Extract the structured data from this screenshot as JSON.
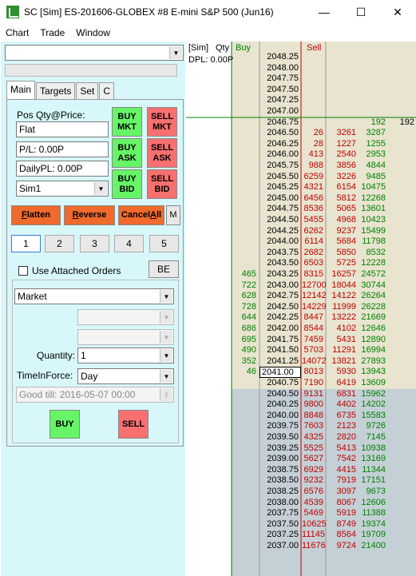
{
  "window": {
    "title": "SC [Sim] ES-201606-GLOBEX  #8  E-mini S&P 500 (Jun16)",
    "minimize": "—",
    "maximize": "☐",
    "close": "✕"
  },
  "menu": [
    "Chart",
    "Trade",
    "Window"
  ],
  "left": {
    "account_combo": "",
    "tabs": [
      "Main",
      "Targets",
      "Set",
      "C"
    ],
    "pos_label": "Pos Qty@Price:",
    "pos_value": "Flat",
    "pl_value": "P/L: 0.00P",
    "daily_pl_value": "DailyPL: 0.00P",
    "account": "Sim1",
    "buy_mkt": [
      "BUY",
      "MKT"
    ],
    "sell_mkt": [
      "SELL",
      "MKT"
    ],
    "buy_ask": [
      "BUY",
      "ASK"
    ],
    "sell_ask": [
      "SELL",
      "ASK"
    ],
    "buy_bid": [
      "BUY",
      "BID"
    ],
    "sell_bid": [
      "SELL",
      "BID"
    ],
    "flatten": "Flatten",
    "reverse": "Reverse",
    "cancel_all": "CancelAll",
    "m": "M",
    "qty_buttons": [
      "1",
      "2",
      "3",
      "4",
      "5"
    ],
    "use_attached": "Use Attached Orders",
    "be": "BE",
    "order_type": "Market",
    "quantity_label": "Quantity:",
    "quantity": "1",
    "tif_label": "TimeInForce:",
    "tif": "Day",
    "good_till": "Good till: 2016-05-07 00:00",
    "buy": "BUY",
    "sell": "SELL"
  },
  "ladder": {
    "header_sim": "[Sim]",
    "header_qty": "Qty",
    "header_buy": "Buy",
    "header_sell": "Sell",
    "dpl": "DPL: 0.00P",
    "colors": {
      "ask_bg": "#e8e4cf",
      "bid_bg": "#c4d0d6",
      "buy": "#008000",
      "sell": "#c00000"
    },
    "rows": [
      {
        "p": "2048.25",
        "b": "",
        "s": "",
        "v1": "",
        "v2": "",
        "v3": "",
        "z": "a"
      },
      {
        "p": "2048.00",
        "b": "",
        "s": "",
        "v1": "",
        "v2": "",
        "v3": "",
        "z": "a"
      },
      {
        "p": "2047.75",
        "b": "",
        "s": "",
        "v1": "",
        "v2": "",
        "v3": "",
        "z": "a"
      },
      {
        "p": "2047.50",
        "b": "",
        "s": "",
        "v1": "",
        "v2": "",
        "v3": "",
        "z": "a"
      },
      {
        "p": "2047.25",
        "b": "",
        "s": "",
        "v1": "",
        "v2": "",
        "v3": "",
        "z": "a"
      },
      {
        "p": "2047.00",
        "b": "",
        "s": "",
        "v1": "",
        "v2": "",
        "v3": "",
        "z": "a"
      },
      {
        "p": "2046.75",
        "b": "",
        "s": "",
        "v1": "",
        "v2": "192",
        "v3": "192",
        "z": "a"
      },
      {
        "p": "2046.50",
        "b": "",
        "s": "26",
        "v1": "3261",
        "v2": "3287",
        "v3": "",
        "z": "a"
      },
      {
        "p": "2046.25",
        "b": "",
        "s": "28",
        "v1": "1227",
        "v2": "1255",
        "v3": "",
        "z": "a"
      },
      {
        "p": "2046.00",
        "b": "",
        "s": "413",
        "v1": "2540",
        "v2": "2953",
        "v3": "",
        "z": "a"
      },
      {
        "p": "2045.75",
        "b": "",
        "s": "988",
        "v1": "3856",
        "v2": "4844",
        "v3": "",
        "z": "a"
      },
      {
        "p": "2045.50",
        "b": "",
        "s": "6259",
        "v1": "3226",
        "v2": "9485",
        "v3": "",
        "z": "a"
      },
      {
        "p": "2045.25",
        "b": "",
        "s": "4321",
        "v1": "6154",
        "v2": "10475",
        "v3": "",
        "z": "a"
      },
      {
        "p": "2045.00",
        "b": "",
        "s": "6456",
        "v1": "5812",
        "v2": "12268",
        "v3": "",
        "z": "a"
      },
      {
        "p": "2044.75",
        "b": "",
        "s": "8536",
        "v1": "5065",
        "v2": "13601",
        "v3": "",
        "z": "a"
      },
      {
        "p": "2044.50",
        "b": "",
        "s": "5455",
        "v1": "4968",
        "v2": "10423",
        "v3": "",
        "z": "a"
      },
      {
        "p": "2044.25",
        "b": "",
        "s": "6262",
        "v1": "9237",
        "v2": "15499",
        "v3": "",
        "z": "a"
      },
      {
        "p": "2044.00",
        "b": "",
        "s": "6114",
        "v1": "5684",
        "v2": "11798",
        "v3": "",
        "z": "a"
      },
      {
        "p": "2043.75",
        "b": "",
        "s": "2682",
        "v1": "5850",
        "v2": "8532",
        "v3": "",
        "z": "a"
      },
      {
        "p": "2043.50",
        "b": "",
        "s": "6503",
        "v1": "5725",
        "v2": "12228",
        "v3": "",
        "z": "a"
      },
      {
        "p": "2043.25",
        "b": "465",
        "s": "8315",
        "v1": "16257",
        "v2": "24572",
        "v3": "",
        "z": "a"
      },
      {
        "p": "2043.00",
        "b": "722",
        "s": "12700",
        "v1": "18044",
        "v2": "30744",
        "v3": "",
        "z": "a"
      },
      {
        "p": "2042.75",
        "b": "628",
        "s": "12142",
        "v1": "14122",
        "v2": "26264",
        "v3": "",
        "z": "a"
      },
      {
        "p": "2042.50",
        "b": "728",
        "s": "14229",
        "v1": "11999",
        "v2": "26228",
        "v3": "",
        "z": "a"
      },
      {
        "p": "2042.25",
        "b": "644",
        "s": "8447",
        "v1": "13222",
        "v2": "21669",
        "v3": "",
        "z": "a"
      },
      {
        "p": "2042.00",
        "b": "686",
        "s": "8544",
        "v1": "4102",
        "v2": "12646",
        "v3": "",
        "z": "a"
      },
      {
        "p": "2041.75",
        "b": "695",
        "s": "7459",
        "v1": "5431",
        "v2": "12890",
        "v3": "",
        "z": "a"
      },
      {
        "p": "2041.50",
        "b": "490",
        "s": "5703",
        "v1": "11291",
        "v2": "16994",
        "v3": "",
        "z": "a"
      },
      {
        "p": "2041.25",
        "b": "352",
        "s": "14072",
        "v1": "13821",
        "v2": "27893",
        "v3": "",
        "z": "a"
      },
      {
        "p": "2041.00",
        "b": "46",
        "s": "8013",
        "v1": "5930",
        "v2": "13943",
        "v3": "",
        "z": "c"
      },
      {
        "p": "2040.75",
        "b": "",
        "s": "7190",
        "v1": "6419",
        "v2": "13609",
        "v3": "",
        "z": "b"
      },
      {
        "p": "2040.50",
        "b": "",
        "s": "9131",
        "v1": "6831",
        "v2": "15962",
        "v3": "",
        "z": "b"
      },
      {
        "p": "2040.25",
        "b": "",
        "s": "9800",
        "v1": "4402",
        "v2": "14202",
        "v3": "",
        "z": "b"
      },
      {
        "p": "2040.00",
        "b": "",
        "s": "8848",
        "v1": "6735",
        "v2": "15583",
        "v3": "",
        "z": "b"
      },
      {
        "p": "2039.75",
        "b": "",
        "s": "7603",
        "v1": "2123",
        "v2": "9726",
        "v3": "",
        "z": "b"
      },
      {
        "p": "2039.50",
        "b": "",
        "s": "4325",
        "v1": "2820",
        "v2": "7145",
        "v3": "",
        "z": "b"
      },
      {
        "p": "2039.25",
        "b": "",
        "s": "5525",
        "v1": "5413",
        "v2": "10938",
        "v3": "",
        "z": "b"
      },
      {
        "p": "2039.00",
        "b": "",
        "s": "5627",
        "v1": "7542",
        "v2": "13169",
        "v3": "",
        "z": "b"
      },
      {
        "p": "2038.75",
        "b": "",
        "s": "6929",
        "v1": "4415",
        "v2": "11344",
        "v3": "",
        "z": "b"
      },
      {
        "p": "2038.50",
        "b": "",
        "s": "9232",
        "v1": "7919",
        "v2": "17151",
        "v3": "",
        "z": "b"
      },
      {
        "p": "2038.25",
        "b": "",
        "s": "6576",
        "v1": "3097",
        "v2": "9673",
        "v3": "",
        "z": "b"
      },
      {
        "p": "2038.00",
        "b": "",
        "s": "4539",
        "v1": "8067",
        "v2": "12606",
        "v3": "",
        "z": "b"
      },
      {
        "p": "2037.75",
        "b": "",
        "s": "5469",
        "v1": "5919",
        "v2": "11388",
        "v3": "",
        "z": "b"
      },
      {
        "p": "2037.50",
        "b": "",
        "s": "10625",
        "v1": "8749",
        "v2": "19374",
        "v3": "",
        "z": "b"
      },
      {
        "p": "2037.25",
        "b": "",
        "s": "11145",
        "v1": "8564",
        "v2": "19709",
        "v3": "",
        "z": "b"
      },
      {
        "p": "2037.00",
        "b": "",
        "s": "11676",
        "v1": "9724",
        "v2": "21400",
        "v3": "",
        "z": "b"
      }
    ]
  }
}
